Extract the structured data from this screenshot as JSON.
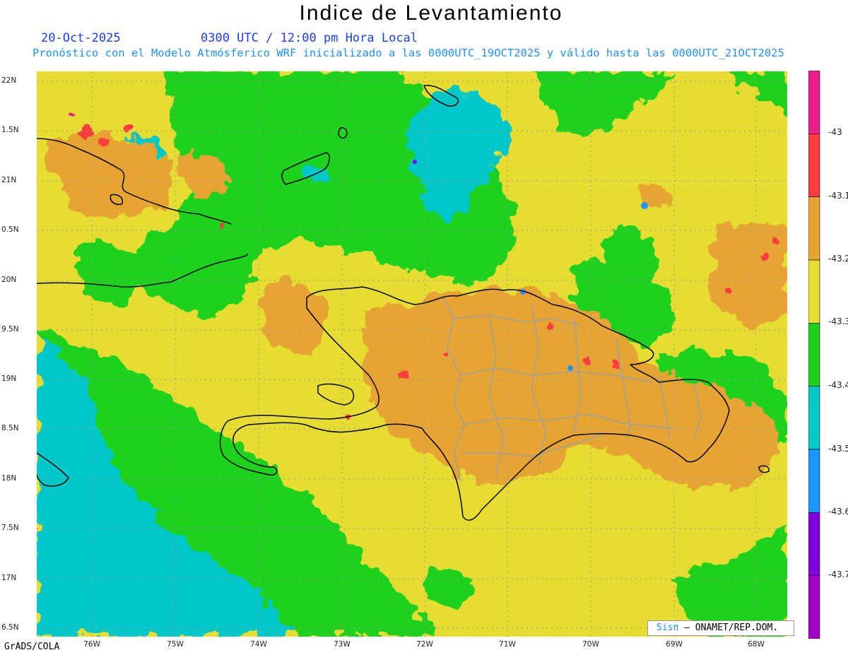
{
  "header": {
    "title": "Indice de Levantamiento",
    "date": "20-Oct-2025",
    "time": "0300 UTC / 12:00 pm Hora Local",
    "subtitle": "Pronóstico con el Modelo Atmósferico WRF inicializado a las 0000UTC_19OCT2025 y válido hasta las  0000UTC_21OCT2025"
  },
  "axes": {
    "lat_labels": [
      "22N",
      "1.5N",
      "21N",
      "0.5N",
      "20N",
      "9.5N",
      "19N",
      "8.5N",
      "18N",
      "7.5N",
      "17N",
      "6.5N"
    ],
    "lon_labels": [
      "76W",
      "75W",
      "74W",
      "73W",
      "72W",
      "71W",
      "70W",
      "69W",
      "68W"
    ]
  },
  "colorbar": {
    "labels": [
      "-43",
      "-43.1",
      "-43.2",
      "-43.3",
      "-43.4",
      "-43.5",
      "-43.6",
      "-43.7"
    ],
    "colors": [
      "#ec1e8c",
      "#fa3c3c",
      "#e6a532",
      "#e6dc32",
      "#1ed21e",
      "#00c8c8",
      "#1e96ff",
      "#8200dc",
      "#a000c8"
    ]
  },
  "credit": {
    "logo": "Sisπ",
    "text": " – ONAMET/REP.DOM."
  },
  "footer": "GrADS/COLA"
}
